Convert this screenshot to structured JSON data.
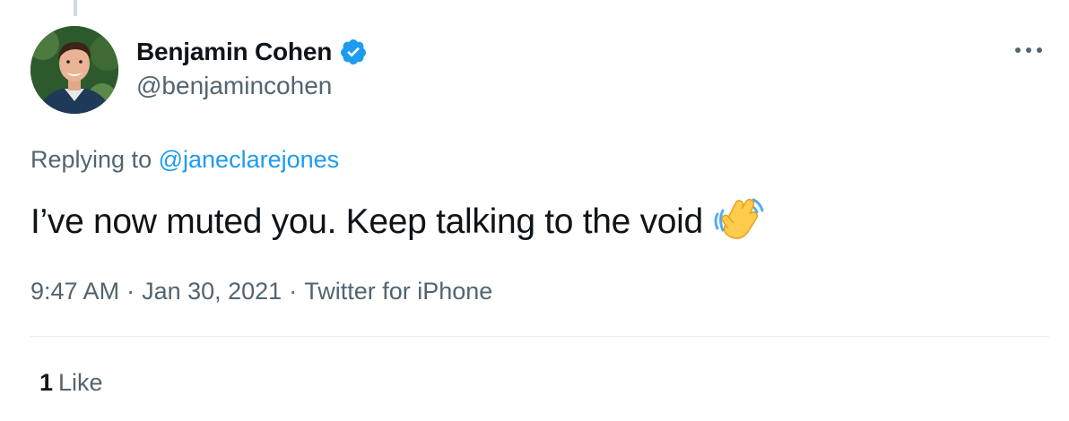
{
  "tweet": {
    "author": {
      "display_name": "Benjamin Cohen",
      "handle": "@benjamincohen",
      "verified": true
    },
    "reply_prefix": "Replying to",
    "reply_to": "@janeclarejones",
    "text": "I’ve now muted you. Keep talking to the void",
    "emoji": "waving-hand",
    "time": "9:47 AM",
    "date": "Jan 30, 2021",
    "separator": "·",
    "source": "Twitter for iPhone",
    "likes": {
      "count": "1",
      "label": "Like"
    }
  },
  "icons": {
    "more": "more-horizontal-icon",
    "verified": "verified-badge-icon"
  },
  "colors": {
    "link": "#1d9bf0",
    "secondary_text": "#536471",
    "primary_text": "#0f1419",
    "verified": "#1d9bf0"
  }
}
